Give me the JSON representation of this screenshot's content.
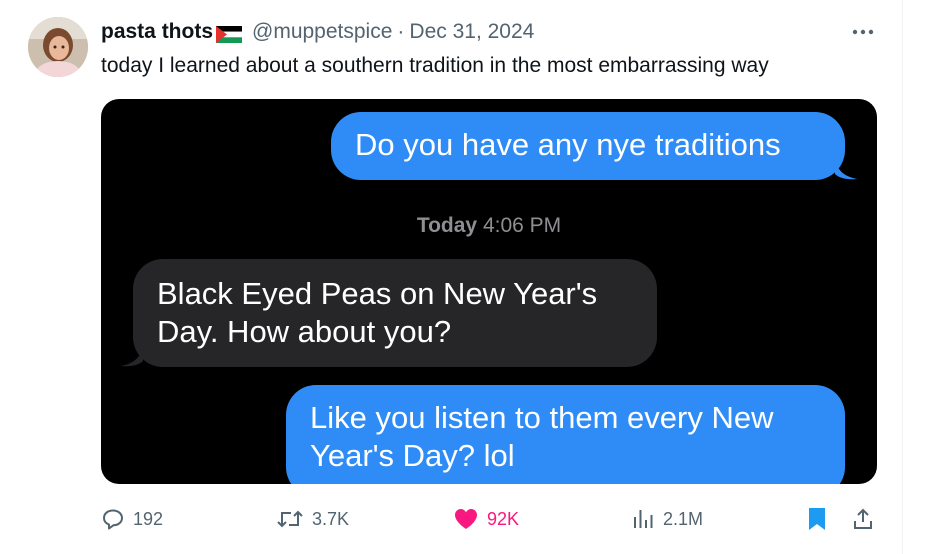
{
  "author": {
    "display_name": "pasta thots",
    "handle": "@muppetspice",
    "separator": "·",
    "date": "Dec 31, 2024"
  },
  "tweet": {
    "text": "today I learned about a southern tradition in the most embarrassing way"
  },
  "screenshot": {
    "messages": [
      {
        "direction": "outgoing",
        "text": "Do you have any nye traditions"
      },
      {
        "direction": "incoming",
        "text": "Black Eyed Peas on New Year's Day. How about you?"
      },
      {
        "direction": "outgoing",
        "text": "Like you listen to them every New Year's Day? lol"
      }
    ],
    "timestamp_day": "Today",
    "timestamp_time": "4:06 PM"
  },
  "actions": {
    "replies": "192",
    "reposts": "3.7K",
    "likes": "92K",
    "views": "2.1M"
  },
  "colors": {
    "like_active": "#f91880",
    "bookmark_active": "#1d9bf0",
    "imessage_blue": "#2f8cf6",
    "imessage_gray": "#262629"
  },
  "icons": {
    "reply": "reply-icon",
    "repost": "repost-icon",
    "like": "heart-icon",
    "views": "views-icon",
    "bookmark": "bookmark-icon",
    "share": "share-icon",
    "more": "more-icon",
    "flag": "palestine-flag-icon"
  }
}
